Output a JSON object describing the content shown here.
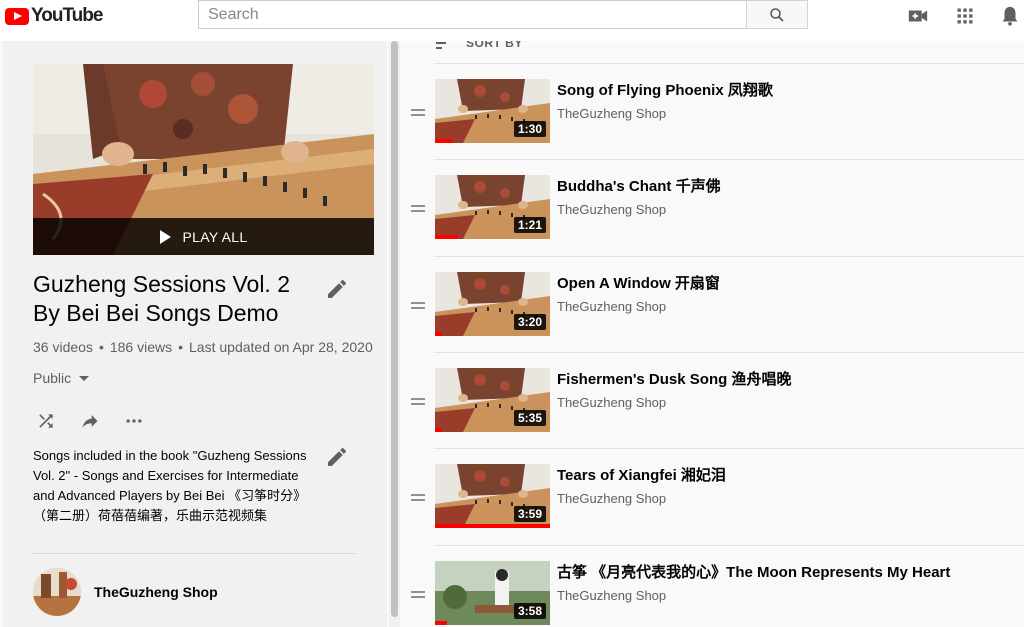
{
  "header": {
    "logo_text": "YouTube",
    "search_placeholder": "Search",
    "icons": [
      "search-icon",
      "create-video-icon",
      "apps-icon",
      "notifications-icon"
    ]
  },
  "playlist": {
    "play_all_label": "PLAY ALL",
    "title": "Guzheng Sessions Vol. 2 By Bei Bei Songs Demo",
    "video_count": "36 videos",
    "views": "186 views",
    "last_updated": "Last updated on Apr 28, 2020",
    "privacy": "Public",
    "description": "Songs included in the book \"Guzheng Sessions Vol. 2\" - Songs and Exercises for Intermediate and Advanced Players by Bei Bei 《习筝时分》（第二册）荷蓓蓓编著，乐曲示范视频集",
    "owner": "TheGuzheng Shop",
    "action_icons": [
      "shuffle-icon",
      "share-icon",
      "more-icon"
    ]
  },
  "list": {
    "sort_label": "SORT BY",
    "items": [
      {
        "title": "Song of Flying Phoenix 凤翔歌",
        "channel": "TheGuzheng Shop",
        "duration": "1:30",
        "watched": 0.15
      },
      {
        "title": "Buddha's Chant 千声佛",
        "channel": "TheGuzheng Shop",
        "duration": "1:21",
        "watched": 0.2
      },
      {
        "title": "Open A Window 开扇窗",
        "channel": "TheGuzheng Shop",
        "duration": "3:20",
        "watched": 0.06
      },
      {
        "title": "Fishermen's Dusk Song 渔舟唱晚",
        "channel": "TheGuzheng Shop",
        "duration": "5:35",
        "watched": 0.06
      },
      {
        "title": "Tears of Xiangfei 湘妃泪",
        "channel": "TheGuzheng Shop",
        "duration": "3:59",
        "watched": 1.0
      },
      {
        "title": "古筝 《月亮代表我的心》The Moon Represents My Heart",
        "channel": "TheGuzheng Shop",
        "duration": "3:58",
        "watched": 0.1
      }
    ]
  },
  "colors": {
    "brand_red": "#ff0000",
    "panel_bg": "#f1f1f1",
    "text_secondary": "#606060"
  }
}
